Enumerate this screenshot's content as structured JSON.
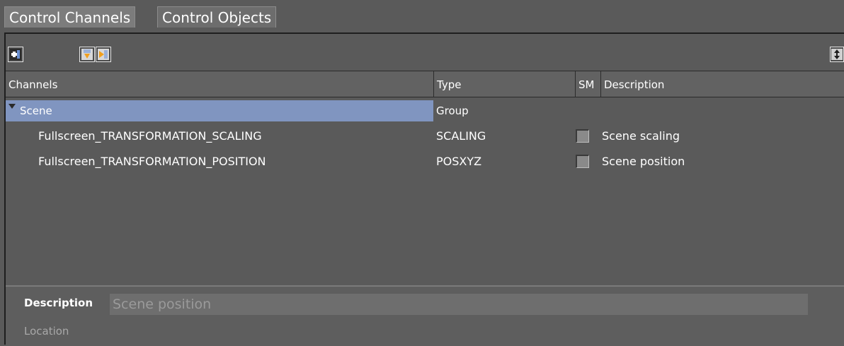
{
  "tabs": [
    {
      "label": "Control Channels",
      "active": true
    },
    {
      "label": "Control Objects",
      "active": false
    }
  ],
  "toolbar": {
    "buttons": [
      {
        "icon": "add-channel-icon"
      },
      {
        "icon": "import-icon"
      },
      {
        "icon": "export-icon"
      },
      {
        "icon": "expand-vertical-icon"
      }
    ]
  },
  "table": {
    "columns": [
      "Channels",
      "Type",
      "SM",
      "Description"
    ],
    "group": {
      "name": "Scene",
      "type": "Group",
      "expanded": true
    },
    "rows": [
      {
        "channel": "Fullscreen_TRANSFORMATION_SCALING",
        "type": "SCALING",
        "sm": false,
        "description": "Scene scaling"
      },
      {
        "channel": "Fullscreen_TRANSFORMATION_POSITION",
        "type": "POSXYZ",
        "sm": false,
        "description": "Scene position"
      }
    ]
  },
  "details": {
    "description_label": "Description",
    "description_value": "Scene position",
    "location_label": "Location"
  },
  "colors": {
    "background": "#5a5a5a",
    "selection": "#8095c0",
    "accent_orange": "#f0a020"
  }
}
